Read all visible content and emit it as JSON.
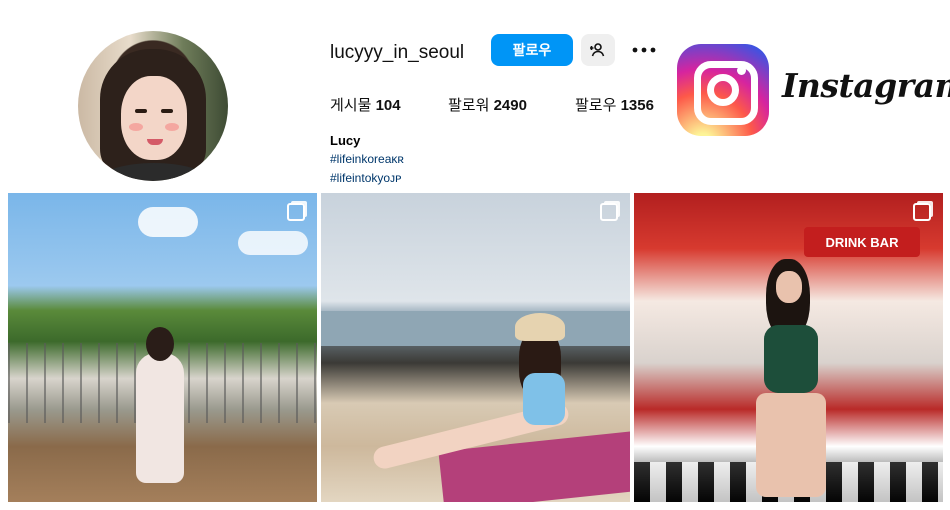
{
  "profile": {
    "username": "lucyyy_in_seoul",
    "follow_label": "팔로우",
    "posts_label": "게시물",
    "posts_count": "104",
    "followers_label": "팔로워",
    "followers_count": "2490",
    "following_label": "팔로우",
    "following_count": "1356",
    "name": "Lucy",
    "bio_tags": [
      "#lifeinkoreaᴋʀ",
      "#lifeintokyoᴊᴘ"
    ]
  },
  "brand": {
    "wordmark": "Instagram",
    "logo_icon": "instagram-logo-icon"
  },
  "posts": [
    {
      "icon": "multiple-photos-icon"
    },
    {
      "icon": "multiple-photos-icon"
    },
    {
      "icon": "multiple-photos-icon",
      "sign_text": "DRINK BAR"
    }
  ],
  "colors": {
    "follow_button": "#0095f6",
    "link": "#00376b",
    "secondary_button": "#efefef"
  }
}
